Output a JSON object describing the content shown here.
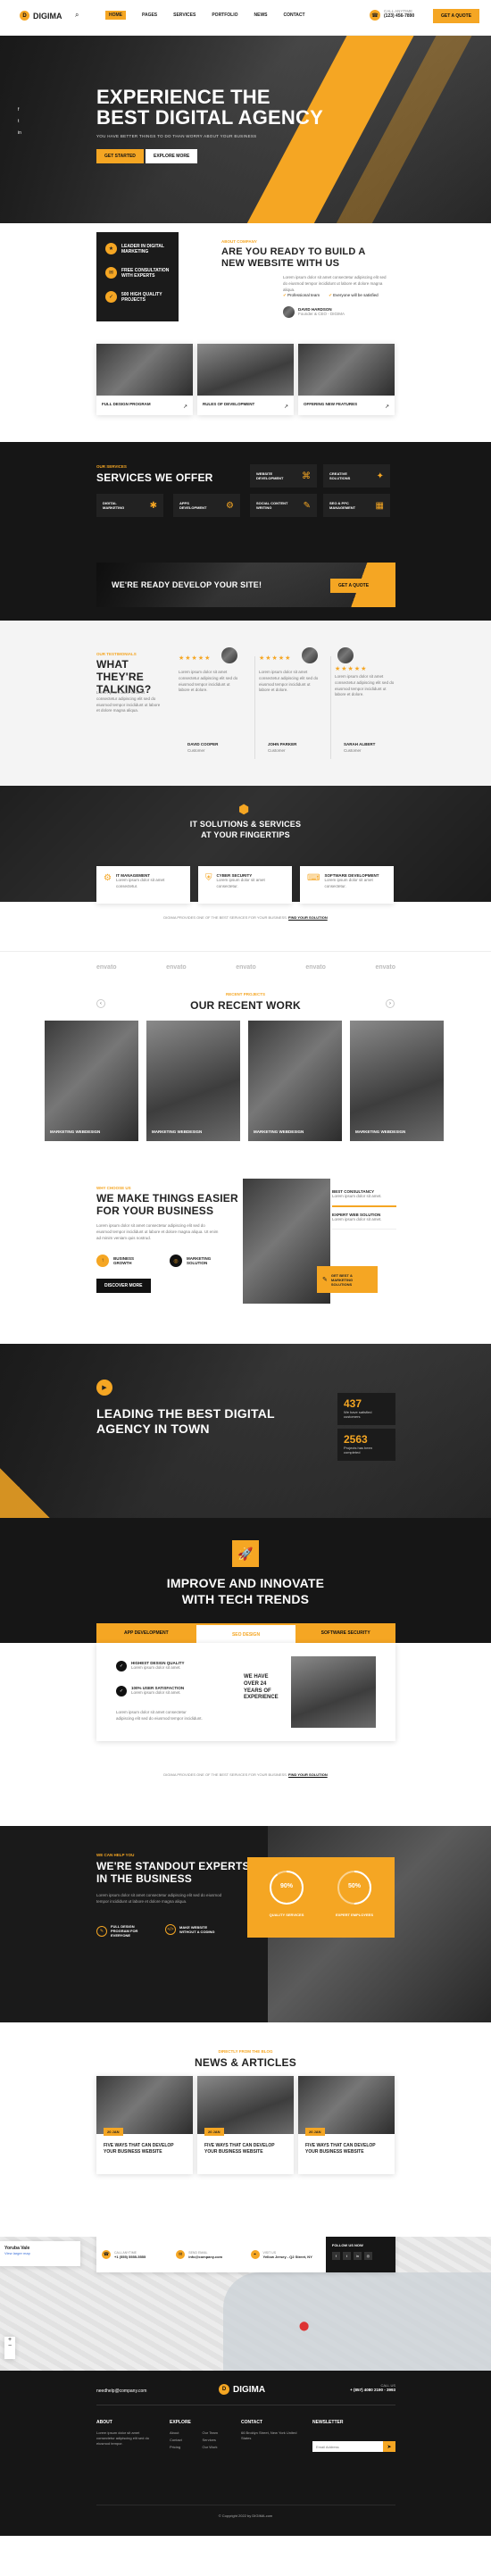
{
  "brand": {
    "name": "DIGIMA"
  },
  "header": {
    "nav": [
      "HOME",
      "PAGES",
      "SERVICES",
      "PORTFOLIO",
      "NEWS",
      "CONTACT"
    ],
    "contact_label": "CALL ANYTIME",
    "phone": "(123) 456-7890",
    "cta": "GET A QUOTE"
  },
  "hero": {
    "title_line1": "EXPERIENCE THE",
    "title_line2": "BEST DIGITAL AGENCY",
    "subtitle": "YOU HAVE BETTER THINGS TO DO THAN WORRY ABOUT YOUR BUSINESS",
    "btn1": "GET STARTED",
    "btn2": "EXPLORE MORE",
    "social": [
      "f",
      "t",
      "in"
    ]
  },
  "about": {
    "features": [
      "LEADER IN DIGITAL MARKETING",
      "FREE CONSULTATION WITH EXPERTS",
      "500 HIGH QUALITY PROJECTS"
    ],
    "kicker": "ABOUT COMPANY",
    "title": "ARE YOU READY TO BUILD A NEW WEBSITE WITH US",
    "body": "Lorem ipsum dolor sit amet consectetur adipiscing elit sed do eiusmod tempor incididunt ut labore et dolore magna aliqua.",
    "checks": [
      "Professional team",
      "Everyone will be satisfied"
    ],
    "author": "DAVID HARDSON",
    "author_role": "Founder & CEO - DIGIMA"
  },
  "image_cards": [
    "FULL DESIGN PROGRAM",
    "RULES OF DEVELOPMENT",
    "OFFERING NEW FEATURES"
  ],
  "services": {
    "kicker": "OUR SERVICES",
    "title": "SERVICES WE OFFER",
    "items": [
      "WEBSITE DEVELOPMENT",
      "CREATIVE SOLUTIONS",
      "DIGITAL MARKETING",
      "APPS DEVELOPMENT",
      "SOCIAL CONTENT WRITING",
      "SEO & PPC MANAGEMENT"
    ]
  },
  "banner": {
    "text": "WE'RE READY DEVELOP YOUR SITE!",
    "btn": "GET A QUOTE"
  },
  "testimonials": {
    "kicker": "OUR TESTIMONIALS",
    "title": "WHAT THEY'RE TALKING?",
    "body": "Lorem ipsum dolor sit amet consectetur adipiscing elit sed do eiusmod tempor incididunt ut labore et dolore magna aliqua.",
    "items": [
      {
        "stars": "★★★★★",
        "text": "Lorem ipsum dolor sit amet consectetur adipiscing elit sed do eiusmod tempor incididunt ut labore et dolore.",
        "name": "DAVID COOPER",
        "role": "Customer"
      },
      {
        "stars": "★★★★★",
        "text": "Lorem ipsum dolor sit amet consectetur adipiscing elit sed do eiusmod tempor incididunt ut labore et dolore.",
        "name": "JOHN PARKER",
        "role": "Customer"
      },
      {
        "stars": "★★★★★",
        "text": "Lorem ipsum dolor sit amet consectetur adipiscing elit sed do eiusmod tempor incididunt ut labore et dolore.",
        "name": "SARAH ALBERT",
        "role": "Customer"
      }
    ]
  },
  "it_solutions": {
    "title_line1": "IT SOLUTIONS & SERVICES",
    "title_line2": "AT YOUR FINGERTIPS",
    "items": [
      "IT MANAGEMENT",
      "CYBER SECURITY",
      "SOFTWARE DEVELOPMENT"
    ],
    "note_pre": "DIGIMA PROVIDES ONE OF THE BEST SERVICES FOR YOUR BUSINESS.",
    "note_link": "FIND YOUR SOLUTION"
  },
  "clients": [
    "envato",
    "envato",
    "envato",
    "envato",
    "envato"
  ],
  "work": {
    "kicker": "RECENT PROJECTS",
    "title": "OUR RECENT WORK",
    "items": [
      "MARKETING WEBDESIGN",
      "MARKETING WEBDESIGN",
      "MARKETING WEBDESIGN",
      "MARKETING WEBDESIGN"
    ]
  },
  "easier": {
    "kicker": "WHY CHOOSE US",
    "title_line1": "WE MAKE THINGS EASIER",
    "title_line2": "FOR YOUR BUSINESS",
    "body": "Lorem ipsum dolor sit amet consectetur adipiscing elit sed do eiusmod tempor incididunt ut labore et dolore magna aliqua. Ut enim ad minim veniam quis nostrud.",
    "f1": "BUSINESS GROWTH",
    "f2": "MARKETING SOLUTION",
    "btn": "DISCOVER MORE",
    "tabs": [
      "BEST CONSULTANCY",
      "EXPERT WEB SOLUTION"
    ],
    "badge": "GET BEST & MARKETING SOLUTIONS"
  },
  "leading": {
    "title_line1": "LEADING THE BEST DIGITAL",
    "title_line2": "AGENCY IN TOWN",
    "stat1": "437",
    "stat1_label": "We have satisfied customers",
    "stat2": "2563",
    "stat2_label": "Projects has been completed"
  },
  "improve": {
    "title_line1": "IMPROVE AND INNOVATE",
    "title_line2": "WITH TECH TRENDS",
    "tabs": [
      "APP DEVELOPMENT",
      "SEO DESIGN",
      "SOFTWARE SECURITY"
    ],
    "checks": [
      "HIGHEST DESIGN QUALITY",
      "100% USER SATISFACTION"
    ],
    "years": "WE HAVE OVER 24 YEARS OF EXPERIENCE",
    "body": "Lorem ipsum dolor sit amet consectetur adipiscing elit sed do eiusmod tempor incididunt.",
    "note_pre": "DIGIMA PROVIDES ONE OF THE BEST SERVICES FOR YOUR BUSINESS.",
    "note_link": "FIND YOUR SOLUTION"
  },
  "experts": {
    "kicker": "WE CAN HELP YOU",
    "title_line1": "WE'RE STANDOUT EXPERTS",
    "title_line2": "IN THE BUSINESS",
    "body": "Lorem ipsum dolor sit amet consectetur adipiscing elit sed do eiusmod tempor incididunt ut labore et dolore magna aliqua.",
    "f1": "FULL DESIGN PROGRAM FOR EVERYONE",
    "f2": "MAKE WEBSITE WITHOUT A CODING",
    "p1": "90%",
    "p1_label": "QUALITY SERVICES",
    "p2": "50%",
    "p2_label": "EXPERT EMPLOYEES",
    "progress1": 0.9,
    "progress2": 0.5
  },
  "news": {
    "kicker": "DIRECTLY FROM THE BLOG",
    "title": "NEWS & ARTICLES",
    "items": [
      "FIVE WAYS THAT CAN DEVELOP YOUR BUSINESS WEBSITE",
      "FIVE WAYS THAT CAN DEVELOP YOUR BUSINESS WEBSITE",
      "FIVE WAYS THAT CAN DEVELOP YOUR BUSINESS WEBSITE"
    ]
  },
  "contact_bar": {
    "c1_label": "CALL ANYTIME",
    "c1": "+1 (555) 5555-5555",
    "c2_label": "SEND EMAIL",
    "c2": "info@company.com",
    "c3_label": "VISIT US",
    "c3": "Yellow Jersey - Q2 Street, NY",
    "social_label": "FOLLOW US NOW"
  },
  "map": {
    "box_title": "Yoruba Vale",
    "box_sub": "View larger map",
    "zoom_in": "+",
    "zoom_out": "−"
  },
  "footer": {
    "email": "needhelp@company.com",
    "brand": "DIGIMA",
    "phone_label": "CALL US",
    "phone": "+ (857) 4080 2190 - 3993",
    "cols": [
      "ABOUT",
      "EXPLORE",
      "CONTACT",
      "NEWSLETTER"
    ],
    "about_text": "Lorem ipsum dolor sit amet consectetur adipiscing elit sed do eiusmod tempor.",
    "explore": [
      "About",
      "Our Team",
      "Contact",
      "Services",
      "Pricing",
      "Our Work"
    ],
    "contact_text": "66 Broklyn Street, New York United States",
    "newsletter_placeholder": "Email Address",
    "copyright": "© Copyright 2022 by DIGIMA.com"
  }
}
